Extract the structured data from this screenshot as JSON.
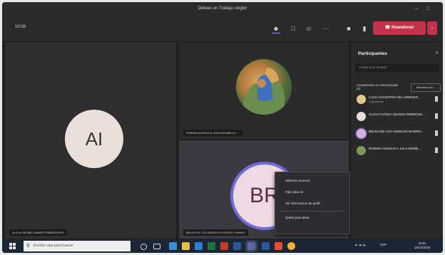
{
  "window": {
    "title": "Debate un Trabajo cleglor"
  },
  "toolbar": {
    "timer": "10:08",
    "leave_label": "Abandonar",
    "icons": [
      "share-icon",
      "chat-icon",
      "reactions-icon",
      "more-icon",
      "camera-icon",
      "mic-icon",
      "share-tray-icon"
    ]
  },
  "stage": {
    "left_initials": "AI",
    "left_name": "ALICIA FATIMA LINARES RIMINGUERO",
    "top_name": "ROMINA ANGELICA JULIA BOMBILLO",
    "bottom_initials": "BR",
    "bottom_name": "BELEN DE LOS ANGELES RIVERO FRANKO"
  },
  "context_menu": {
    "items": [
      "Silenciar anuncio",
      "Fijar para mi",
      "Ver informacion de perfil",
      "Quitar para atras"
    ]
  },
  "participants": {
    "title": "Participantes",
    "invite_placeholder": "Invitar a un usuario",
    "section_label": "Actualmente en esta llamada (4)",
    "mute_all_label": "Silenciar a to...",
    "people": [
      {
        "name": "LUCIA VALENTINA DE LORENZO...",
        "sub": "Organizador",
        "color": "#e7c88c"
      },
      {
        "name": "ALICIA FATIMA LINARES RIMINGUE...",
        "sub": "",
        "color": "#eadfd9"
      },
      {
        "name": "BELEN DE LOS ANGELES RIVERO...",
        "sub": "",
        "color": "#d8b1cf"
      },
      {
        "name": "ROMINA ANGELICA JULIA BOMB...",
        "sub": "",
        "color": "#7a9a5a"
      }
    ]
  },
  "taskbar": {
    "search_placeholder": "Escribe aqui para buscar",
    "time": "10:51",
    "date": "16/10/2020",
    "lang": "ESP"
  },
  "colors": {
    "accent": "#6f6cd8",
    "leave": "#c4314b",
    "taskbar": "#1c2533"
  }
}
